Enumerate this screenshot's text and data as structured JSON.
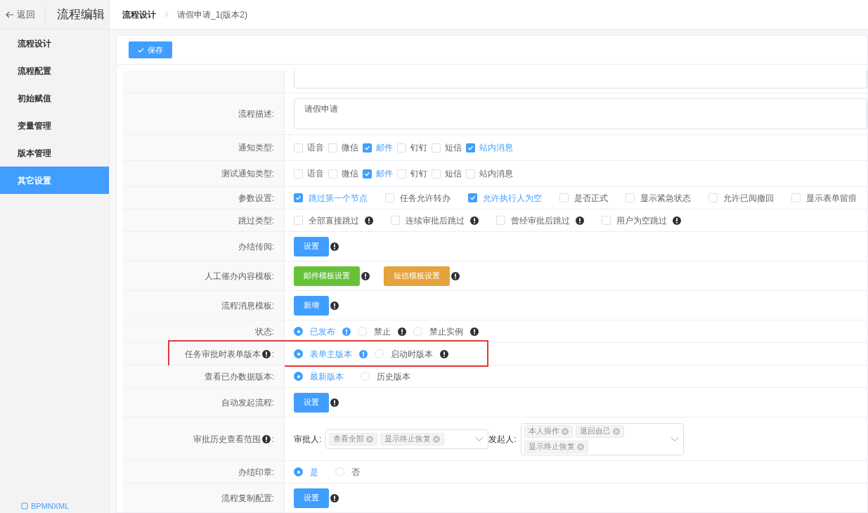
{
  "sidebar": {
    "back": "返回",
    "title": "流程编辑",
    "items": [
      {
        "text": "流程设计",
        "selected": false
      },
      {
        "text": "流程配置",
        "selected": false
      },
      {
        "text": "初始赋值",
        "selected": false
      },
      {
        "text": "变量管理",
        "selected": false
      },
      {
        "text": "版本管理",
        "selected": false
      },
      {
        "text": "其它设置",
        "selected": true
      }
    ],
    "footer_link": "BPMNXML"
  },
  "breadcrumb": [
    "流程设计",
    "请假申请_1(版本2)"
  ],
  "toolbar": {
    "save": "保存"
  },
  "rows": [
    {
      "kind": "input"
    },
    {
      "kind": "textarea",
      "label": "流程描述:",
      "value": "请假申请"
    },
    {
      "kind": "inline-checkboxes",
      "label": "通知类型:",
      "options": [
        {
          "text": "语音",
          "checked": false
        },
        {
          "text": "微信",
          "checked": false
        },
        {
          "text": "邮件",
          "checked": true
        },
        {
          "text": "钉钉",
          "checked": false
        },
        {
          "text": "短信",
          "checked": false
        },
        {
          "text": "站内消息",
          "checked": true
        }
      ]
    },
    {
      "kind": "inline-checkboxes",
      "label": "测试通知类型:",
      "options": [
        {
          "text": "语音",
          "checked": false
        },
        {
          "text": "微信",
          "checked": false
        },
        {
          "text": "邮件",
          "checked": true
        },
        {
          "text": "钉钉",
          "checked": false
        },
        {
          "text": "短信",
          "checked": false
        },
        {
          "text": "站内消息",
          "checked": false
        }
      ]
    },
    {
      "kind": "spaced-checkboxes",
      "label": "参数设置:",
      "options": [
        {
          "text": "跳过第一个节点",
          "checked": true
        },
        {
          "text": "任务允许转办",
          "checked": false
        },
        {
          "text": "允许执行人为空",
          "checked": true
        },
        {
          "text": "是否正式",
          "checked": false
        },
        {
          "text": "显示紧急状态",
          "checked": false
        },
        {
          "text": "允许已阅撤回",
          "checked": false
        },
        {
          "text": "显示表单留痕",
          "checked": false
        }
      ]
    },
    {
      "kind": "spaced-checkboxes",
      "label": "跳过类型:",
      "options": [
        {
          "text": "全部直接跳过",
          "checked": false,
          "info": true
        },
        {
          "text": "连续审批后跳过",
          "checked": false,
          "info": true
        },
        {
          "text": "曾经审批后跳过",
          "checked": false,
          "info": true
        },
        {
          "text": "用户为空跳过",
          "checked": false,
          "info": true
        }
      ]
    },
    {
      "kind": "buttons",
      "label": "办结传阅:",
      "buttons": [
        {
          "text": "设置",
          "color": "#409eff"
        }
      ]
    },
    {
      "kind": "buttons",
      "label": "人工催办内容模板:",
      "buttons": [
        {
          "text": "邮件模板设置",
          "color": "#67c23a"
        },
        {
          "text": "短信模板设置",
          "color": "#e6a23c"
        }
      ]
    },
    {
      "kind": "buttons",
      "label": "流程消息模板:",
      "buttons": [
        {
          "text": "新增",
          "color": "#409eff"
        }
      ]
    },
    {
      "kind": "radios",
      "label": "状态:",
      "options": [
        {
          "text": "已发布",
          "selected": true,
          "info": true
        },
        {
          "text": "禁止",
          "selected": false,
          "info": true
        },
        {
          "text": "禁止实例",
          "selected": false,
          "info": true
        }
      ]
    },
    {
      "kind": "radios",
      "label": "任务审批时表单版本",
      "label_info": true,
      "colon": ":",
      "highlighted": true,
      "options": [
        {
          "text": "表单主版本",
          "selected": true,
          "info": true
        },
        {
          "text": "启动时版本",
          "selected": false,
          "info": true
        }
      ]
    },
    {
      "kind": "radios",
      "label": "查看已办数据版本:",
      "options": [
        {
          "text": "最新版本",
          "selected": true
        },
        {
          "text": "历史版本",
          "selected": false
        }
      ]
    },
    {
      "kind": "buttons",
      "label": "自动发起流程:",
      "buttons": [
        {
          "text": "设置",
          "color": "#409eff"
        }
      ]
    },
    {
      "kind": "selects",
      "label": "审批历史查看范围",
      "label_info": true,
      "colon": ":",
      "groups": [
        {
          "label": "审批人:",
          "tags": [
            "查看全部",
            "显示终止恢复"
          ]
        },
        {
          "label": "发起人:",
          "tags": [
            "本人操作",
            "退回自己",
            "显示终止恢复"
          ]
        }
      ]
    },
    {
      "kind": "radios",
      "label": "办结印章:",
      "options": [
        {
          "text": "是",
          "selected": true
        },
        {
          "text": "否",
          "selected": false
        }
      ]
    },
    {
      "kind": "buttons",
      "label": "流程复制配置:",
      "buttons": [
        {
          "text": "设置",
          "color": "#409eff"
        }
      ]
    }
  ]
}
